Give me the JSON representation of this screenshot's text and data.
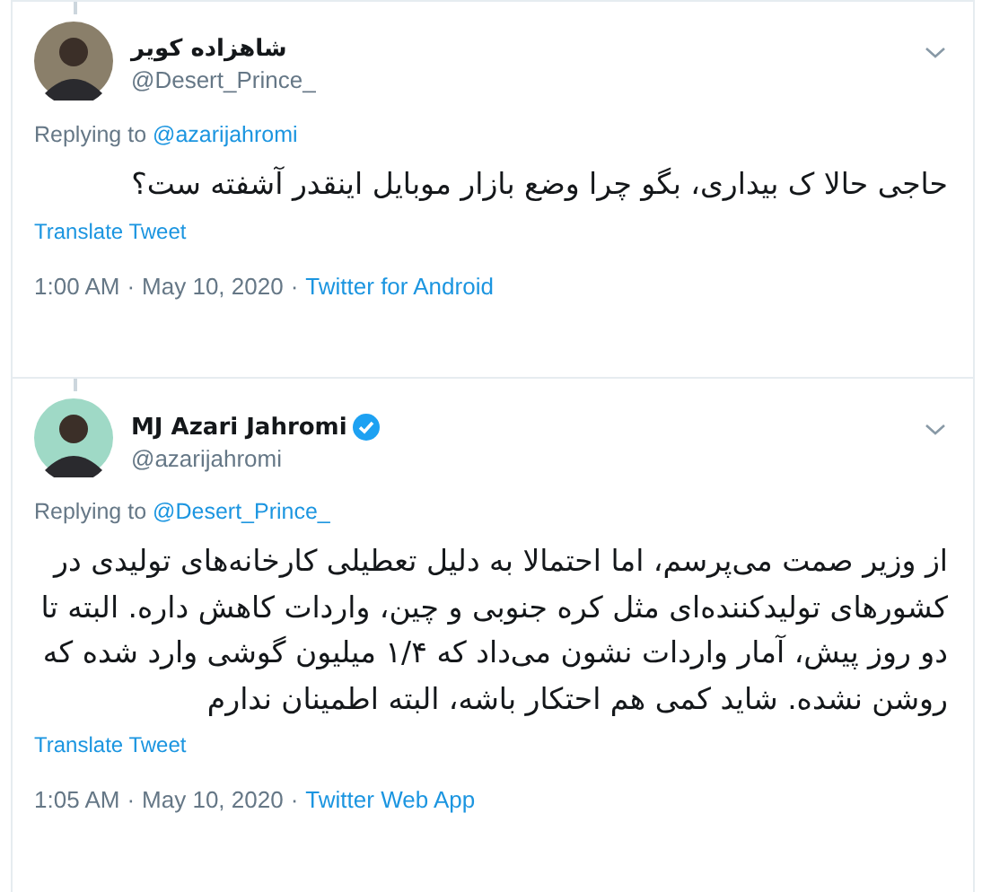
{
  "tweets": [
    {
      "name": "شاهزاده کویر",
      "handle": "@Desert_Prince_",
      "verified": false,
      "replying_label": "Replying to",
      "replying_to": "@azarijahromi",
      "text": "حاجی حالا ک بیداری، بگو چرا وضع بازار موبایل اینقدر آشفته ست؟",
      "translate": "Translate Tweet",
      "time": "1:00 AM",
      "date": "May 10, 2020",
      "source": "Twitter for Android",
      "separator": "·"
    },
    {
      "name": "MJ Azari Jahromi",
      "handle": "@azarijahromi",
      "verified": true,
      "replying_label": "Replying to",
      "replying_to": "@Desert_Prince_",
      "text": "از وزیر صمت می‌پرسم، اما احتمالا به دلیل تعطیلی کارخانه‌های تولیدی در کشورهای تولیدکننده‌ای مثل کره جنوبی و چین، واردات کاهش داره. البته تا دو روز پیش، آمار واردات نشون می‌داد که ۱/۴ میلیون گوشی وارد شده که روشن نشده. شاید کمی هم احتکار باشه، البته اطمینان ندارم",
      "translate": "Translate Tweet",
      "time": "1:05 AM",
      "date": "May 10, 2020",
      "source": "Twitter Web App",
      "separator": "·"
    }
  ]
}
